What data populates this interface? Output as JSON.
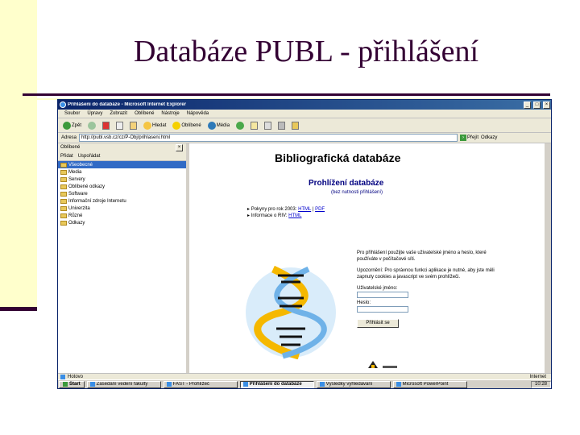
{
  "slide": {
    "title": "Databáze PUBL - přihlášení"
  },
  "window": {
    "title": "Přihlášení do databáze - Microsoft Internet Explorer",
    "menu": [
      "Soubor",
      "Úpravy",
      "Zobrazit",
      "Oblíbené",
      "Nástroje",
      "Nápověda"
    ],
    "toolbar": {
      "back": "Zpět",
      "search": "Hledat",
      "favorites": "Oblíbené",
      "media": "Média"
    },
    "address_label": "Adresa",
    "address_value": "http://publ.vsb.cz/cz/P-Obj/prihlaseni.html",
    "go_label": "Přejít",
    "links_label": "Odkazy"
  },
  "favorites": {
    "title": "Oblíbené",
    "add_label": "Přidat",
    "organize_label": "Uspořádat",
    "items": [
      {
        "label": "Všeobecné",
        "selected": true
      },
      {
        "label": "Media",
        "selected": false
      },
      {
        "label": "Servery",
        "selected": false
      },
      {
        "label": "Oblíbené odkazy",
        "selected": false
      },
      {
        "label": "Software",
        "selected": false
      },
      {
        "label": "Informační zdroje Internetu",
        "selected": false
      },
      {
        "label": "Univerzita",
        "selected": false
      },
      {
        "label": "Různé",
        "selected": false
      },
      {
        "label": "Odkazy",
        "selected": false
      }
    ]
  },
  "page": {
    "heading": "Bibliografická databáze",
    "subheading": "Prohlížení databáze",
    "note": "(bez nutnosti přihlášení)",
    "links": [
      {
        "prefix": "Pokyny pro rok 2003: ",
        "html": "HTML",
        "pdf": "PDF"
      },
      {
        "prefix": "Informace o RIV: ",
        "html": "HTML",
        "pdf": ""
      }
    ],
    "info_1": "Pro přihlášení použijte vaše uživatelské jméno a heslo, které používáte v počítačové síti.",
    "info_2": "Upozornění: Pro správnou funkci aplikace je nutné, aby jste měli zapnuty cookies a javascript ve svém prohlížeči.",
    "username_label": "Uživatelské jméno:",
    "password_label": "Heslo:",
    "login_button": "Přihlásit se"
  },
  "statusbar": {
    "text": "Hotovo",
    "zone": "Internet"
  },
  "taskbar": {
    "start": "Start",
    "tasks": [
      {
        "label": "Zasedání vedení fakulty",
        "active": false
      },
      {
        "label": "FAST - Prohlížeč",
        "active": false
      },
      {
        "label": "Přihlášení do databáze",
        "active": true
      },
      {
        "label": "Výsledky vyhledávání",
        "active": false
      },
      {
        "label": "Microsoft PowerPoint",
        "active": false
      }
    ],
    "clock": "10:28"
  },
  "colors": {
    "slide_accent": "#330033",
    "slide_band": "#ffffcc",
    "ie_titlebar": "#0a246a",
    "link": "#0000cc"
  }
}
